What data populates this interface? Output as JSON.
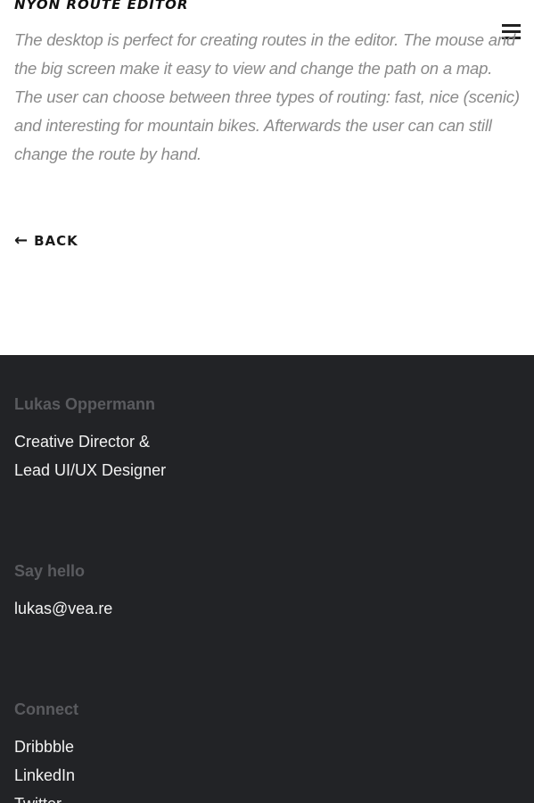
{
  "project": {
    "title": "NYON ROUTE EDITOR",
    "description": "The desktop is perfect for creating routes in the editor. The mouse and the big screen make it easy to view and change the path on a map. The user can choose between three types of routing: fast, nice (scenic) and interesting for mountain bikes. Afterwards the user can can still change the route by hand."
  },
  "nav": {
    "menu_icon": "hamburger-menu-icon",
    "back_arrow": "←",
    "back_label": "BACK"
  },
  "footer": {
    "name_heading": "Lukas Oppermann",
    "role_line1": "Creative Director &",
    "role_line2": "Lead UI/UX Designer",
    "hello_heading": "Say hello",
    "email": "lukas@vea.re",
    "connect_heading": "Connect",
    "links": [
      "Dribbble",
      "LinkedIn",
      "Twitter"
    ]
  },
  "colors": {
    "footer_background": "#222326",
    "footer_heading": "#5a5b5f",
    "footer_text": "#f2f2f2",
    "description_text": "#8a8a8a"
  }
}
